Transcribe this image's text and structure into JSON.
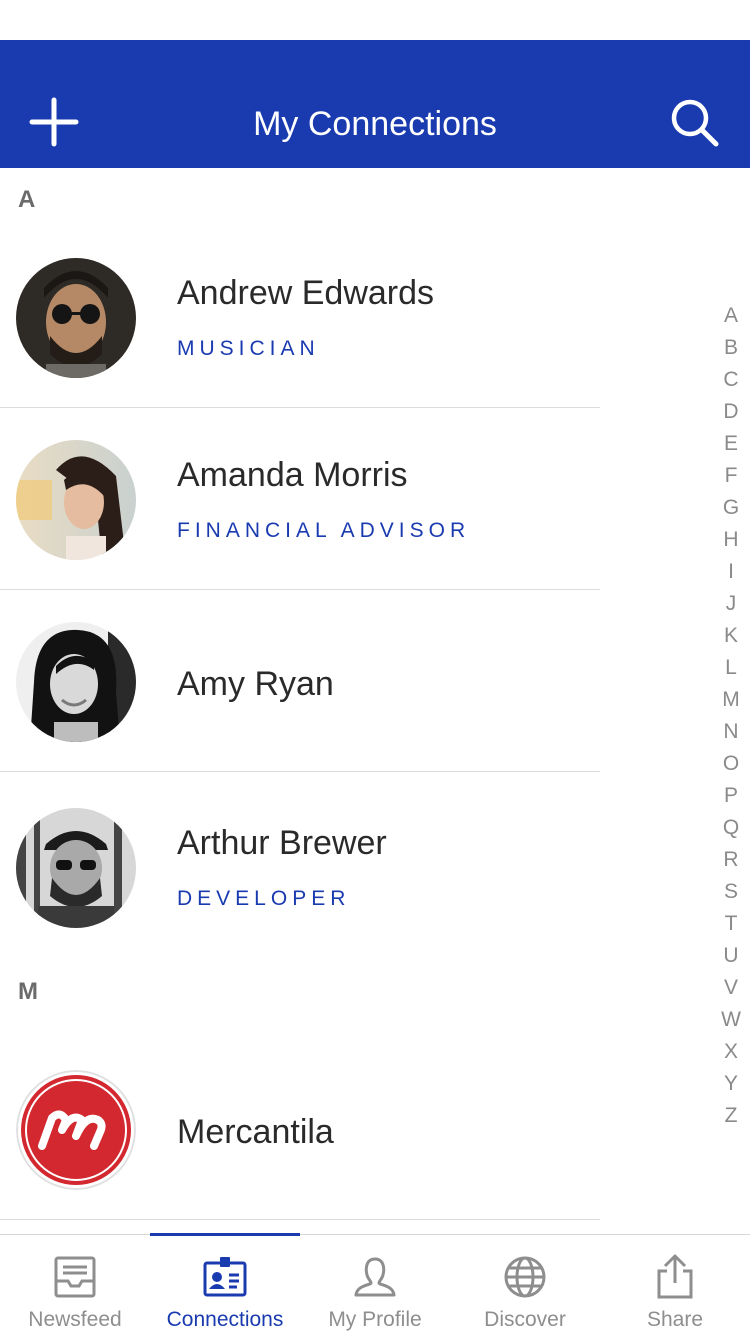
{
  "header": {
    "title": "My Connections",
    "add_icon": "plus-icon",
    "search_icon": "search-icon",
    "background_color": "#1a3bb0"
  },
  "sections": [
    {
      "letter": "A",
      "contacts": [
        {
          "name": "Andrew Edwards",
          "role": "MUSICIAN",
          "avatar": "photo"
        },
        {
          "name": "Amanda Morris",
          "role": "FINANCIAL ADVISOR",
          "avatar": "photo"
        },
        {
          "name": "Amy Ryan",
          "role": "",
          "avatar": "photo"
        },
        {
          "name": "Arthur Brewer",
          "role": "DEVELOPER",
          "avatar": "photo"
        }
      ]
    },
    {
      "letter": "M",
      "contacts": [
        {
          "name": "Mercantila",
          "role": "",
          "avatar": "logo"
        }
      ]
    }
  ],
  "alpha_index": [
    "A",
    "B",
    "C",
    "D",
    "E",
    "F",
    "G",
    "H",
    "I",
    "J",
    "K",
    "L",
    "M",
    "N",
    "O",
    "P",
    "Q",
    "R",
    "S",
    "T",
    "U",
    "V",
    "W",
    "X",
    "Y",
    "Z"
  ],
  "tabbar": {
    "active": "Connections",
    "tabs": [
      {
        "label": "Newsfeed",
        "icon": "inbox-icon"
      },
      {
        "label": "Connections",
        "icon": "id-badge-icon"
      },
      {
        "label": "My Profile",
        "icon": "person-icon"
      },
      {
        "label": "Discover",
        "icon": "globe-icon"
      },
      {
        "label": "Share",
        "icon": "share-icon"
      }
    ]
  },
  "colors": {
    "accent": "#1a3bb0",
    "name_text": "#2a2a2a",
    "inactive_tab": "#8e8e8e",
    "logo_red": "#d3282f"
  }
}
